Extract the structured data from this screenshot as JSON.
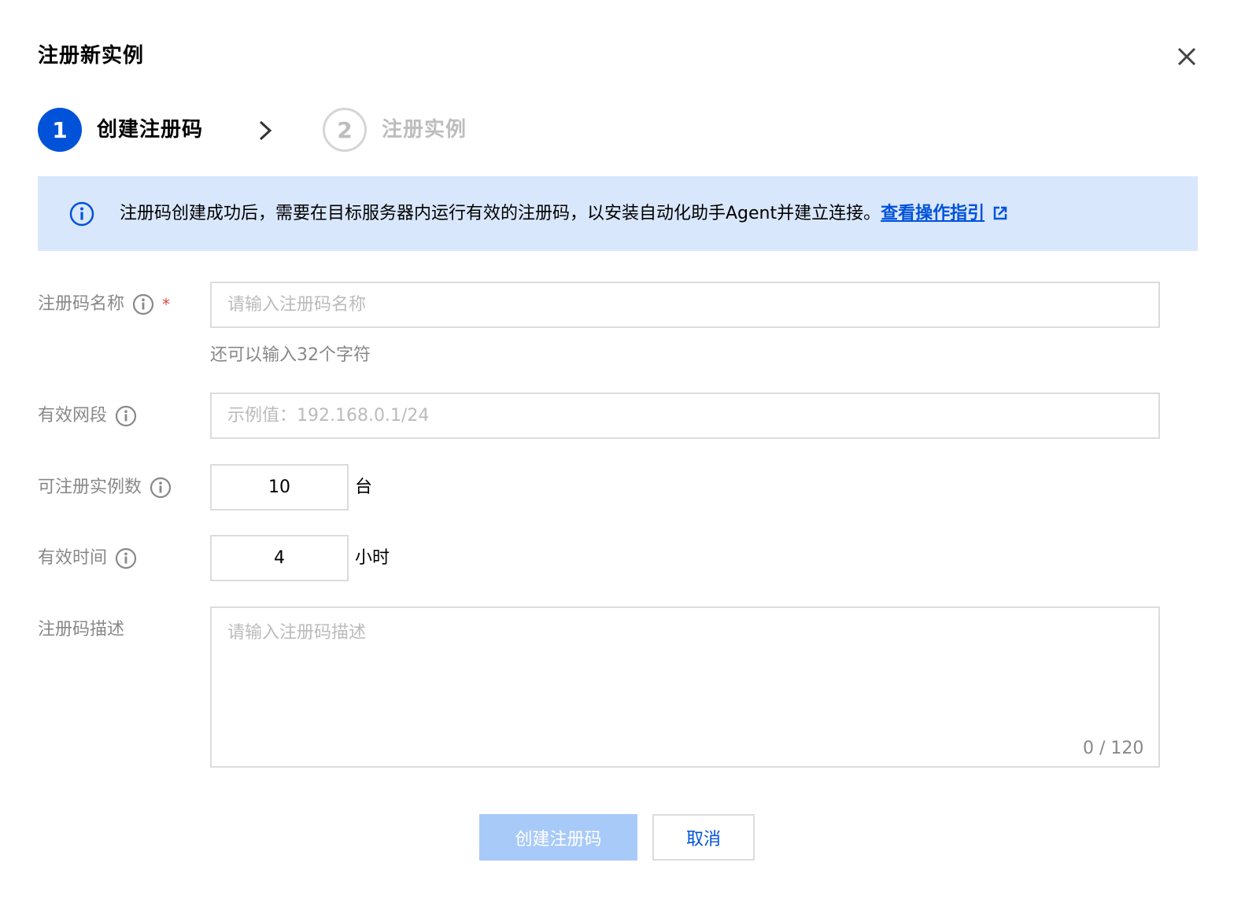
{
  "dialog": {
    "title": "注册新实例"
  },
  "steps": [
    {
      "number": "1",
      "label": "创建注册码",
      "active": true
    },
    {
      "number": "2",
      "label": "注册实例",
      "active": false
    }
  ],
  "alert": {
    "text": "注册码创建成功后，需要在目标服务器内运行有效的注册码，以安装自动化助手Agent并建立连接。",
    "link": "查看操作指引"
  },
  "form": {
    "name": {
      "label": "注册码名称",
      "required_mark": "*",
      "placeholder": "请输入注册码名称",
      "help": "还可以输入32个字符"
    },
    "cidr": {
      "label": "有效网段",
      "placeholder": "示例值：192.168.0.1/24"
    },
    "count": {
      "label": "可注册实例数",
      "value": "10",
      "unit": "台"
    },
    "duration": {
      "label": "有效时间",
      "value": "4",
      "unit": "小时"
    },
    "description": {
      "label": "注册码描述",
      "placeholder": "请输入注册码描述",
      "counter": "0 / 120"
    }
  },
  "buttons": {
    "create": "创建注册码",
    "cancel": "取消"
  },
  "colors": {
    "primary": "#0052d9",
    "primary_disabled": "#a8caf9",
    "alert_bg": "#d9e7fc",
    "required": "#e54545"
  },
  "icons": {
    "close": "close-icon",
    "step_arrow": "chevron-right-icon",
    "alert": "info-circle-icon",
    "external": "external-link-icon",
    "field_help": "info-circle-icon"
  }
}
